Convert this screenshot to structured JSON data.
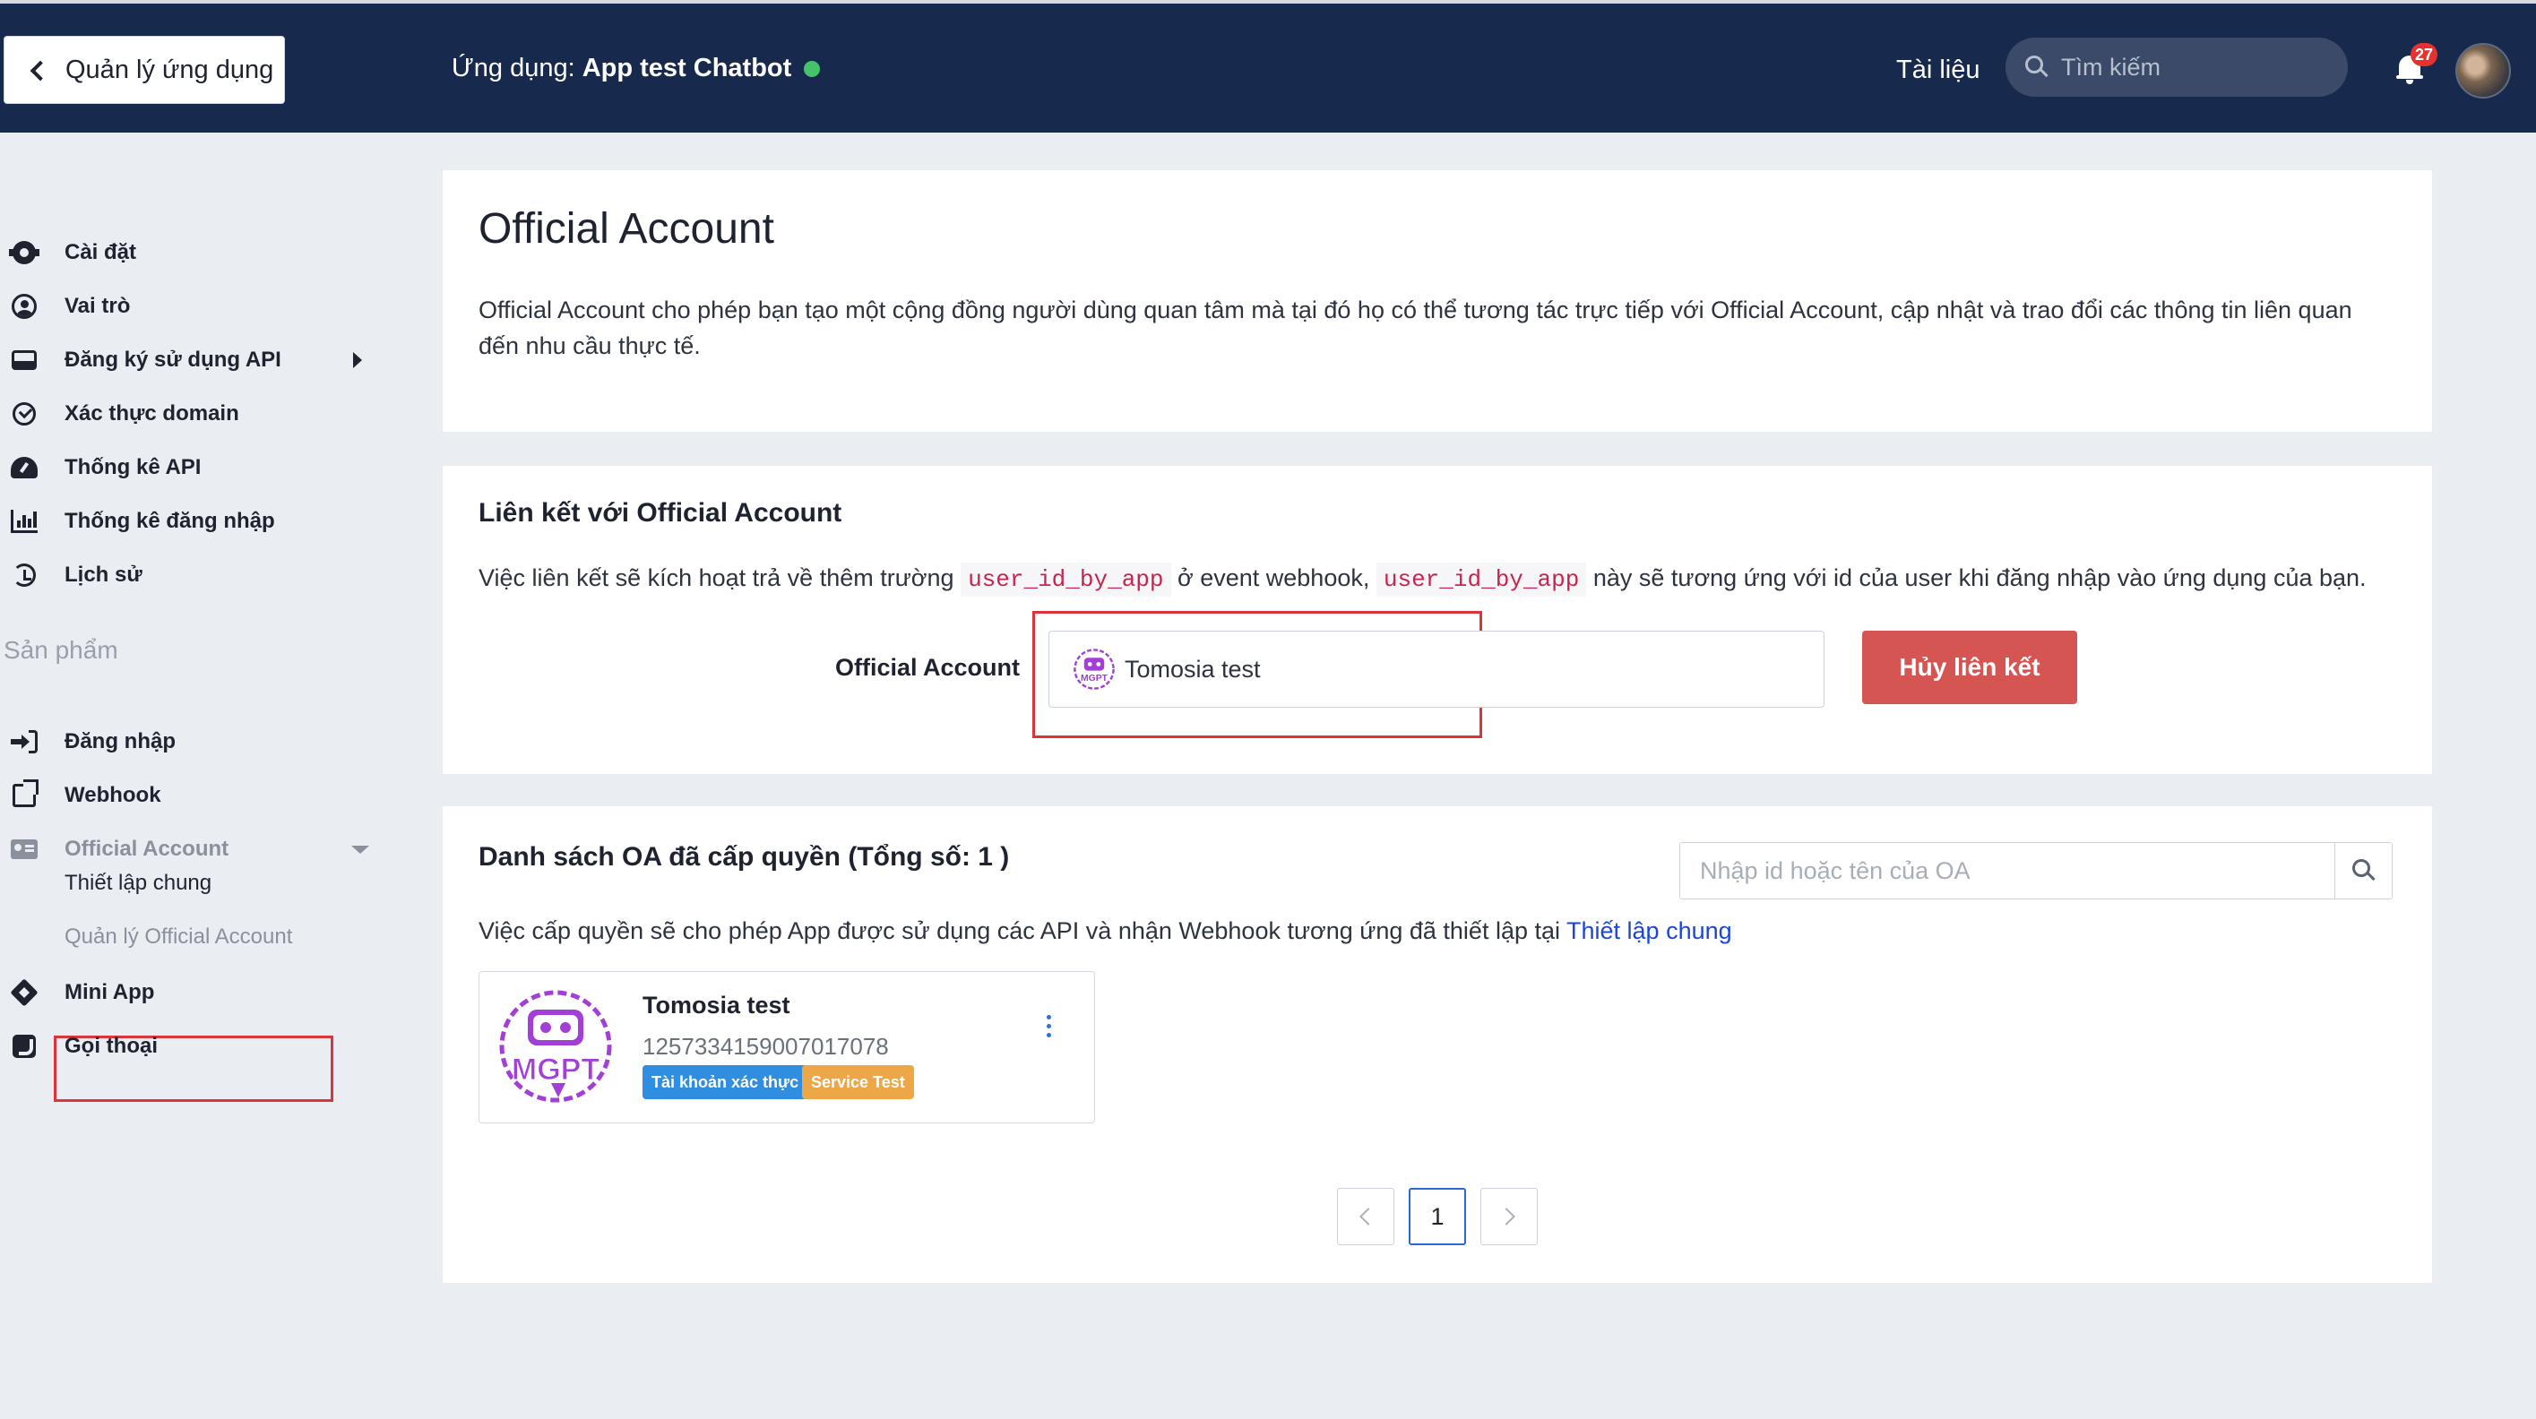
{
  "header": {
    "back_label": "Quản lý ứng dụng",
    "app_prefix": "Ứng dụng:",
    "app_name": "App test Chatbot",
    "status_color": "#44c46a",
    "docs_label": "Tài liệu",
    "search_placeholder": "Tìm kiếm",
    "notification_count": "27",
    "brand_color": "#172a4e"
  },
  "sidebar": {
    "items": [
      {
        "label": "Cài đặt",
        "icon": "gear-icon"
      },
      {
        "label": "Vai trò",
        "icon": "user-circle-icon"
      },
      {
        "label": "Đăng ký sử dụng API",
        "icon": "inbox-icon"
      },
      {
        "label": "Xác thực domain",
        "icon": "check-circle-icon"
      },
      {
        "label": "Thống kê API",
        "icon": "gauge-icon"
      },
      {
        "label": "Thống kê đăng nhập",
        "icon": "bar-chart-icon"
      },
      {
        "label": "Lịch sử",
        "icon": "history-icon"
      }
    ],
    "section_label": "Sản phẩm",
    "product_items": [
      {
        "label": "Đăng nhập",
        "icon": "sign-in-icon"
      },
      {
        "label": "Webhook",
        "icon": "external-link-icon"
      },
      {
        "label": "Official Account",
        "icon": "id-card-icon"
      },
      {
        "label": "Mini App",
        "icon": "cube-icon"
      },
      {
        "label": "Gọi thoại",
        "icon": "phone-icon"
      }
    ],
    "sub_items": [
      {
        "label": "Thiết lập chung"
      },
      {
        "label": "Quản lý Official Account",
        "active": true
      }
    ]
  },
  "main": {
    "title": "Official Account",
    "description": "Official Account cho phép bạn tạo một cộng đồng người dùng quan tâm mà tại đó họ có thể tương tác trực tiếp với Official Account, cập nhật và trao đổi các thông tin liên quan đến nhu cầu thực tế.",
    "link_section": {
      "title": "Liên kết với Official Account",
      "desc_part1": "Việc liên kết sẽ kích hoạt trả về thêm trường",
      "code1": "user_id_by_app",
      "desc_part2": "ở event webhook,",
      "code2": "user_id_by_app",
      "desc_part3": "này sẽ tương ứng với id của user khi đăng nhập vào ứng dụng của bạn.",
      "field_label": "Official Account",
      "selected_oa": "Tomosia test",
      "unlink_label": "Hủy liên kết",
      "unlink_color": "#d45552"
    },
    "list_section": {
      "title": "Danh sách OA đã cấp quyền (Tổng số: 1 )",
      "search_placeholder": "Nhập id hoặc tên của OA",
      "desc": "Việc cấp quyền sẽ cho phép App được sử dụng các API và nhận Webhook tương ứng đã thiết lập tại",
      "desc_link": "Thiết lập chung",
      "cards": [
        {
          "name": "Tomosia test",
          "id": "1257334159007017078",
          "tags": [
            "Tài khoản xác thực",
            "Service Test"
          ],
          "logo_text": "MGPT"
        }
      ],
      "pagination": {
        "current_page": "1"
      }
    }
  }
}
